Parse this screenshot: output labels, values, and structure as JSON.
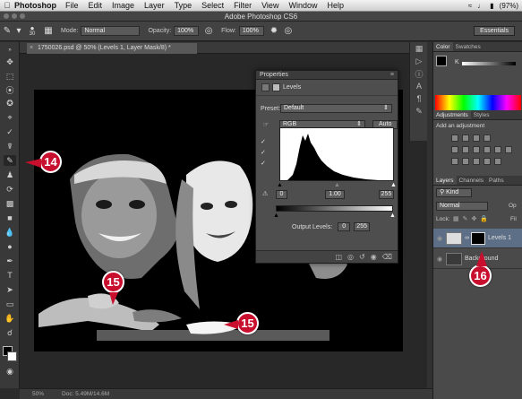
{
  "menubar": {
    "app": "Photoshop",
    "items": [
      "File",
      "Edit",
      "Image",
      "Layer",
      "Type",
      "Select",
      "Filter",
      "View",
      "Window",
      "Help"
    ],
    "battery": "(97%)"
  },
  "titlebar": {
    "title": "Adobe Photoshop CS6"
  },
  "options": {
    "brush_size": "30",
    "mode_label": "Mode:",
    "mode_value": "Normal",
    "opacity_label": "Opacity:",
    "opacity_value": "100%",
    "flow_label": "Flow:",
    "flow_value": "100%",
    "workspace": "Essentials"
  },
  "document": {
    "tab_title": "1750026.psd @ 50% (Levels 1, Layer Mask/8) *"
  },
  "properties": {
    "header": "Properties",
    "panel_type": "Levels",
    "preset_label": "Preset:",
    "preset_value": "Default",
    "channel": "RGB",
    "auto_label": "Auto",
    "input_black": "0",
    "input_gamma": "1.00",
    "input_white": "255",
    "output_label": "Output Levels:",
    "output_black": "0",
    "output_white": "255"
  },
  "right_panel": {
    "color_tabs": [
      "Color",
      "Swatches"
    ],
    "color_channel": "K",
    "adjust_tabs": [
      "Adjustments",
      "Styles"
    ],
    "add_adjustment": "Add an adjustment",
    "layers_tabs": [
      "Layers",
      "Channels",
      "Paths"
    ],
    "kind_filter": "Kind",
    "blend_mode": "Normal",
    "opacity_short": "Op",
    "lock_label": "Lock:",
    "fill_short": "Fil",
    "layers": [
      {
        "name": "Levels 1"
      },
      {
        "name": "Background"
      }
    ]
  },
  "status": {
    "zoom": "50%",
    "doc": "Doc: 5.49M/14.6M"
  },
  "callouts": [
    "14",
    "15",
    "15",
    "16"
  ],
  "colors": {
    "callout": "#c8102e",
    "ui_dark": "#2b2b2b",
    "panel": "#4e4e4e"
  }
}
